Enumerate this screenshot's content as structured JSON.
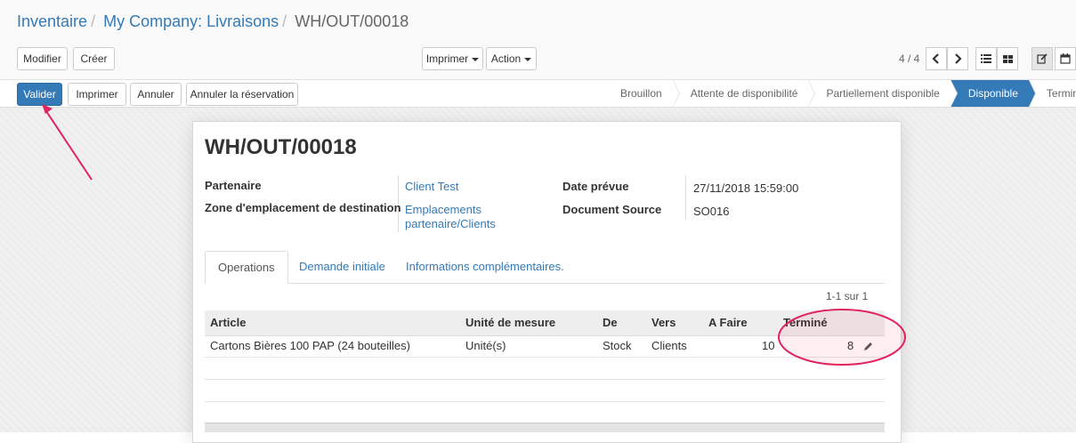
{
  "breadcrumb": [
    "Inventaire",
    "My Company: Livraisons",
    "WH/OUT/00018"
  ],
  "toolbar": {
    "edit_label": "Modifier",
    "create_label": "Créer",
    "print_label": "Imprimer",
    "action_label": "Action",
    "pager": "4 / 4"
  },
  "actions": {
    "validate": "Valider",
    "print": "Imprimer",
    "cancel": "Annuler",
    "unreserve": "Annuler la réservation"
  },
  "stages": [
    "Brouillon",
    "Attente de disponibilité",
    "Partiellement disponible",
    "Disponible",
    "Terminé"
  ],
  "active_stage": "Disponible",
  "record": {
    "name": "WH/OUT/00018",
    "partner_label": "Partenaire",
    "partner_value": "Client Test",
    "dest_label": "Zone d'emplacement de destination",
    "dest_value_line1": "Emplacements",
    "dest_value_line2": "partenaire/Clients",
    "date_label": "Date prévue",
    "date_value": "27/11/2018 15:59:00",
    "source_label": "Document Source",
    "source_value": "SO016"
  },
  "tabs": [
    "Operations",
    "Demande initiale",
    "Informations complémentaires."
  ],
  "table": {
    "count": "1-1 sur 1",
    "headers": [
      "Article",
      "Unité de mesure",
      "De",
      "Vers",
      "A Faire",
      "Terminé"
    ],
    "rows": [
      [
        "Cartons Bières 100 PAP (24 bouteilles)",
        "Unité(s)",
        "Stock",
        "Clients",
        "10",
        "8"
      ]
    ]
  },
  "colors": {
    "primary": "#337ab7",
    "annotation": "#e0245e"
  },
  "icons": {
    "pager_prev": "chevron-left-icon",
    "pager_next": "chevron-right-icon",
    "list_view": "list-view-icon",
    "kanban_view": "kanban-view-icon",
    "form_view": "form-view-icon",
    "calendar_view": "calendar-icon",
    "edit_line": "pencil-icon"
  }
}
